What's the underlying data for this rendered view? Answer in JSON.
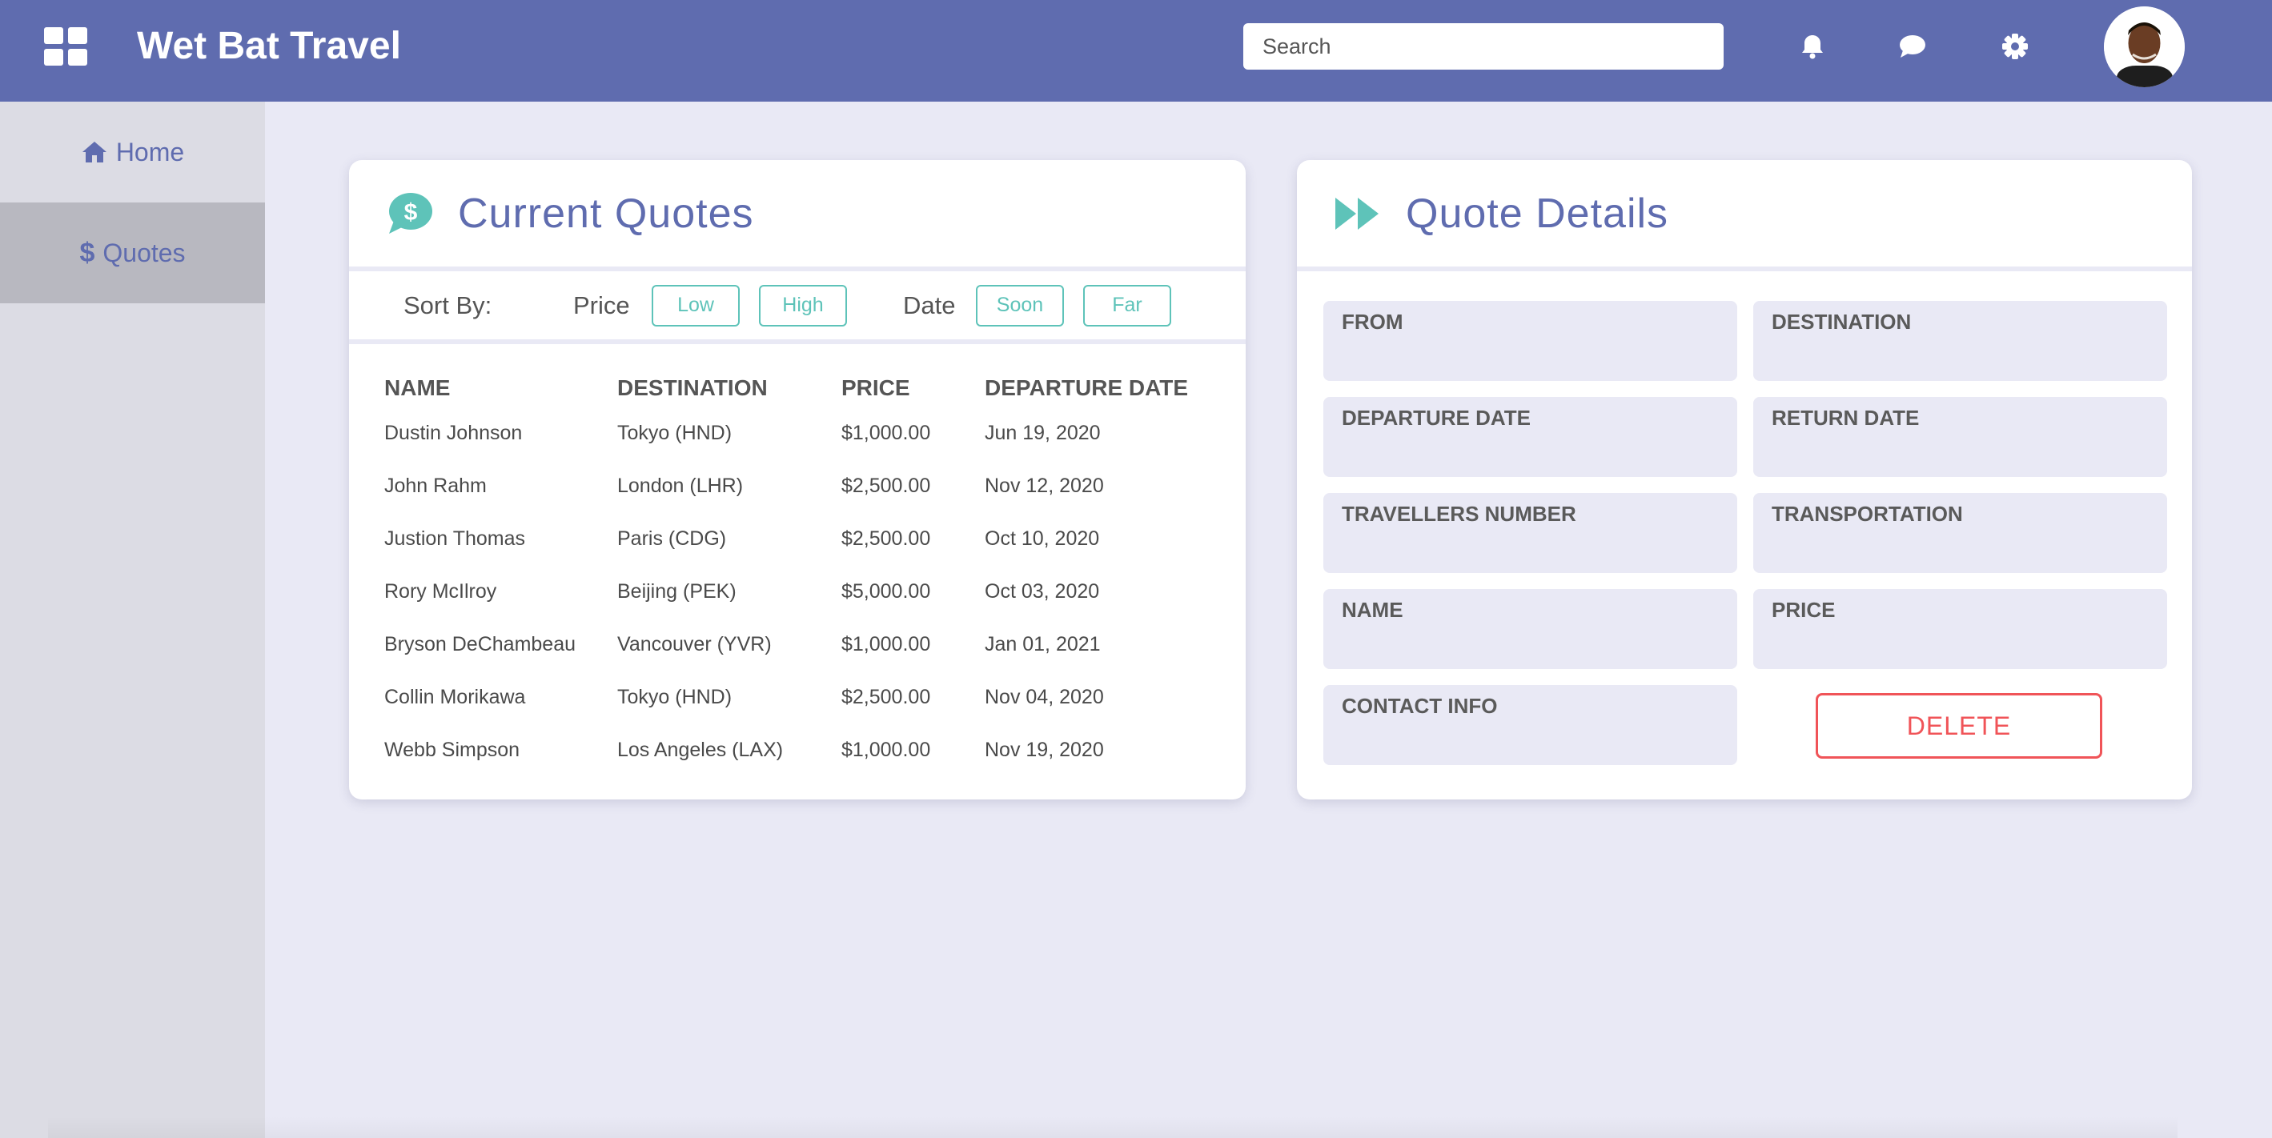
{
  "header": {
    "app_title": "Wet Bat Travel",
    "search_placeholder": "Search",
    "icons": [
      "grid-icon",
      "bell-icon",
      "chat-icon",
      "gear-icon"
    ],
    "brand_color": "#5f6caf"
  },
  "sidebar": {
    "items": [
      {
        "label": "Home",
        "icon": "home-icon",
        "active": false
      },
      {
        "label": "Quotes",
        "icon": "dollar-icon",
        "active": true
      }
    ]
  },
  "quotes": {
    "title": "Current Quotes",
    "sort_label": "Sort By:",
    "price_label": "Price",
    "date_label": "Date",
    "buttons": {
      "low": "Low",
      "high": "High",
      "soon": "Soon",
      "far": "Far"
    },
    "columns": [
      "NAME",
      "DESTINATION",
      "PRICE",
      "DEPARTURE DATE"
    ],
    "rows": [
      [
        "Dustin Johnson",
        "Tokyo (HND)",
        "$1,000.00",
        "Jun 19, 2020"
      ],
      [
        "John Rahm",
        "London (LHR)",
        "$2,500.00",
        "Nov 12, 2020"
      ],
      [
        "Justion Thomas",
        "Paris (CDG)",
        "$2,500.00",
        "Oct 10, 2020"
      ],
      [
        "Rory McIlroy",
        "Beijing (PEK)",
        "$5,000.00",
        "Oct 03, 2020"
      ],
      [
        "Bryson DeChambeau",
        "Vancouver (YVR)",
        "$1,000.00",
        "Jan 01, 2021"
      ],
      [
        "Collin Morikawa",
        "Tokyo (HND)",
        "$2,500.00",
        "Nov 04, 2020"
      ],
      [
        "Webb Simpson",
        "Los Angeles (LAX)",
        "$1,000.00",
        "Nov 19, 2020"
      ]
    ],
    "accent_color": "#5ec3b9"
  },
  "details": {
    "title": "Quote Details",
    "fields": {
      "from": "FROM",
      "destination": "DESTINATION",
      "departure_date": "DEPARTURE DATE",
      "return_date": "RETURN DATE",
      "travellers_number": "TRAVELLERS NUMBER",
      "transportation": "TRANSPORTATION",
      "name": "NAME",
      "price": "PRICE",
      "contact_info": "CONTACT INFO"
    },
    "delete_label": "DELETE",
    "delete_color": "#f05458"
  }
}
